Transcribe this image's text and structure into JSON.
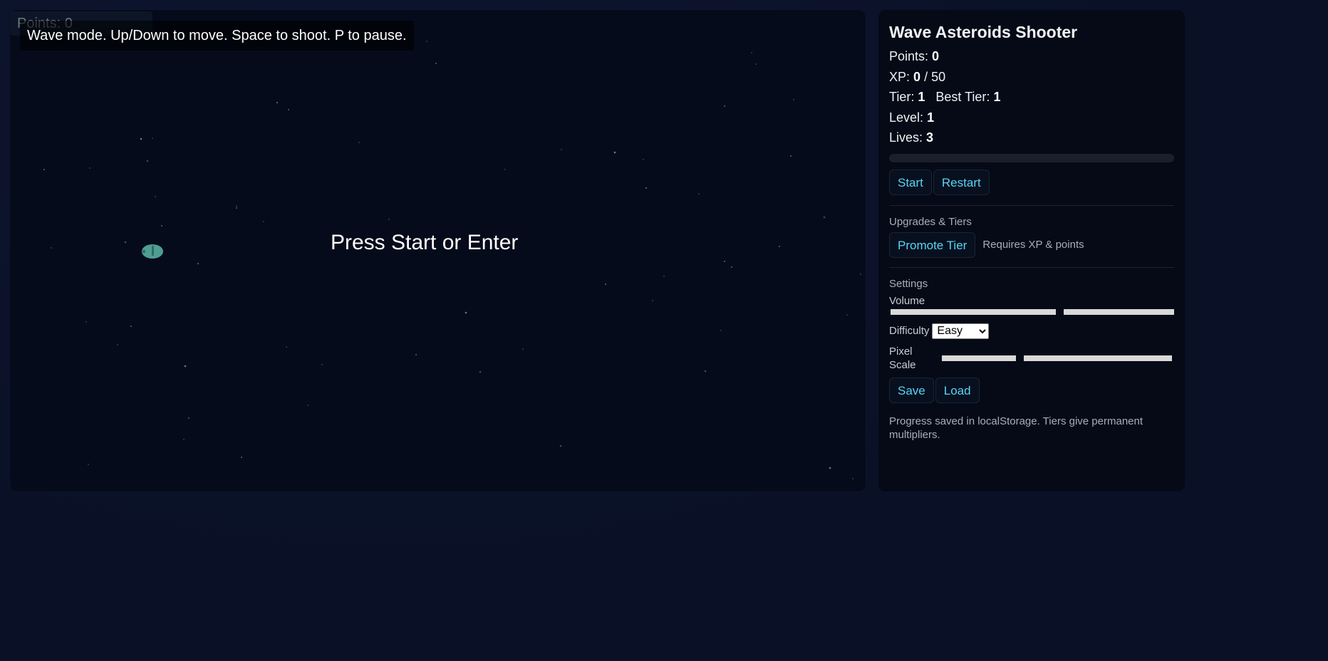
{
  "hud": {
    "points_text": "Points: 0",
    "hint": "Wave mode. Up/Down to move. Space to shoot. P to pause.",
    "center_message": "Press Start or Enter"
  },
  "panel": {
    "title": "Wave Asteroids Shooter",
    "points_label": "Points:",
    "points_value": "0",
    "xp_label": "XP:",
    "xp_value": "0",
    "xp_max": "/ 50",
    "xp_progress": 0,
    "tier_label": "Tier:",
    "tier_value": "1",
    "best_tier_label": "Best Tier:",
    "best_tier_value": "1",
    "level_label": "Level:",
    "level_value": "1",
    "lives_label": "Lives:",
    "lives_value": "3",
    "start_label": "Start",
    "restart_label": "Restart",
    "upgrades_title": "Upgrades & Tiers",
    "promote_label": "Promote Tier",
    "promote_note": "Requires XP & points",
    "settings_title": "Settings",
    "volume_label": "Volume",
    "difficulty_label": "Difficulty",
    "difficulty_value": "Easy",
    "pixel_scale_label": "Pixel Scale",
    "save_label": "Save",
    "load_label": "Load",
    "footnote": "Progress saved in localStorage. Tiers give permanent multipliers."
  },
  "colors": {
    "accent": "#59d4f5",
    "ship": "#4f9e92",
    "background": "#050b1a"
  }
}
